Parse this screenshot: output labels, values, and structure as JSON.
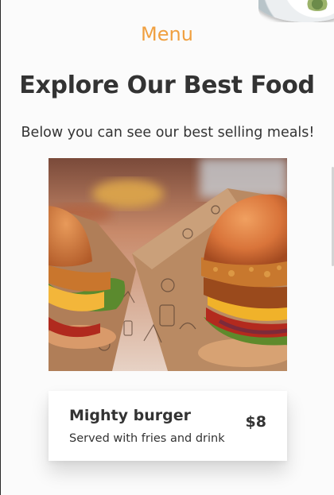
{
  "header": {
    "menu_label": "Menu"
  },
  "main": {
    "title": "Explore Our Best Food",
    "subtitle": "Below you can see our best selling meals!"
  },
  "featured_meal": {
    "image_alt": "burger-photo",
    "name": "Mighty burger",
    "description": "Served with fries and drink",
    "price": "$8"
  },
  "colors": {
    "accent": "#f0a040",
    "text": "#333333",
    "card_background": "#ffffff"
  }
}
